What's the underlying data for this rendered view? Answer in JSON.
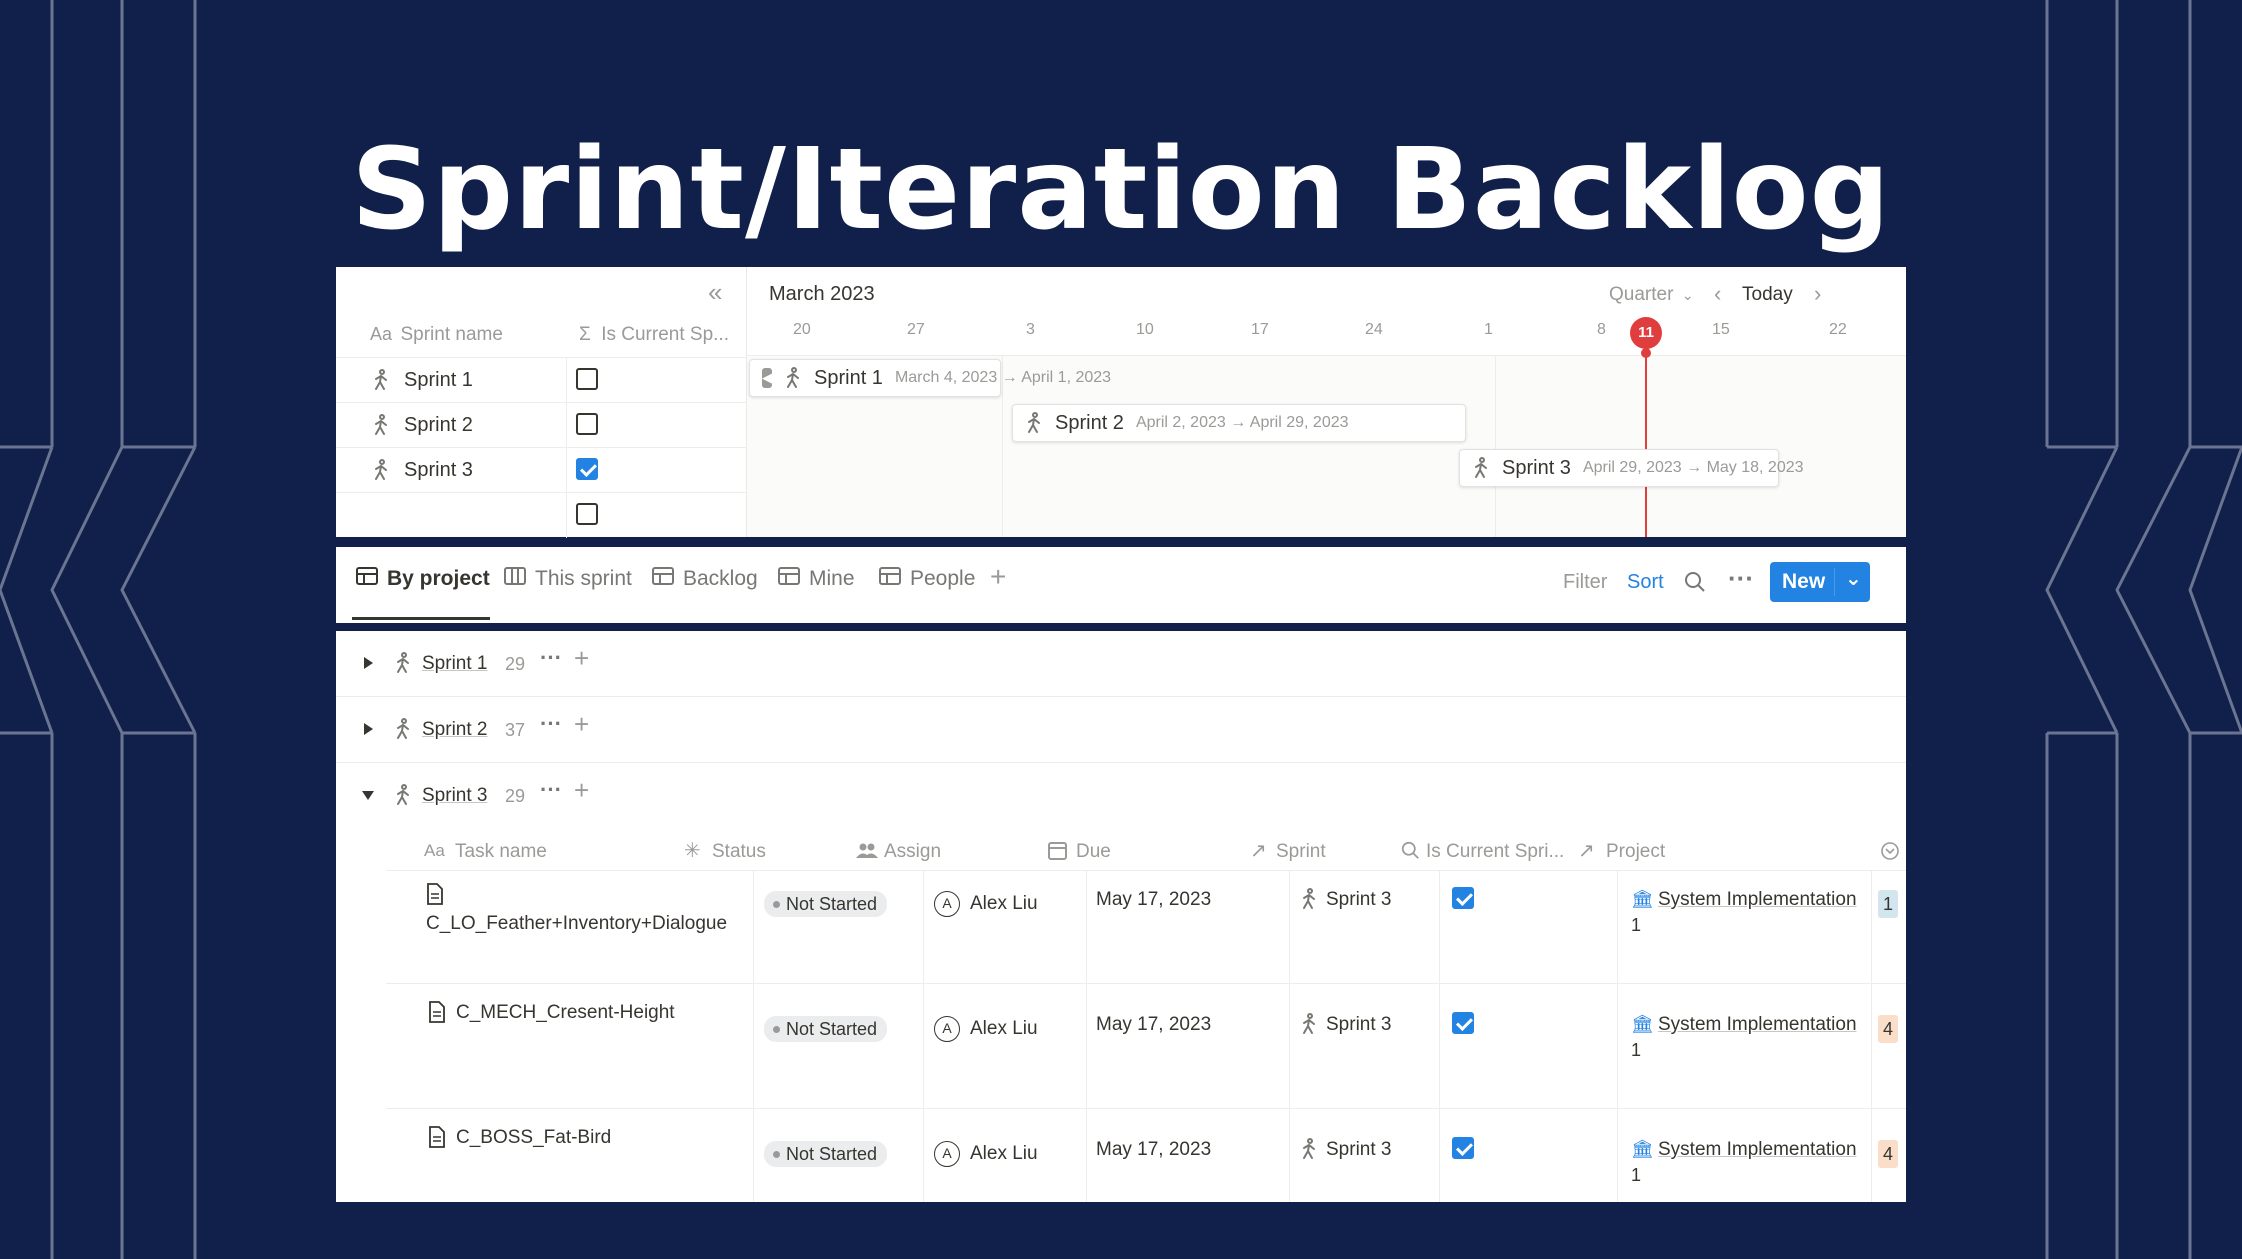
{
  "page_title": "Sprint/Iteration Backlog",
  "colors": {
    "background": "#11204a",
    "accent_blue": "#2383e2",
    "today_red": "#e03e3e",
    "tag_blue_bg": "#d3e5ef",
    "tag_orange_bg": "#fadec9"
  },
  "timeline": {
    "collapse_icon": "double-chevron-left-icon",
    "month_label": "March 2023",
    "view_selector": "Quarter",
    "today_label": "Today",
    "columns": {
      "name": "Sprint name",
      "current": "Is Current Sp..."
    },
    "dates": [
      "20",
      "27",
      "3",
      "10",
      "17",
      "24",
      "1",
      "8",
      "11",
      "15",
      "22"
    ],
    "rows": [
      {
        "name": "Sprint 1",
        "is_current": false
      },
      {
        "name": "Sprint 2",
        "is_current": false
      },
      {
        "name": "Sprint 3",
        "is_current": true
      },
      {
        "name": "",
        "is_current": false
      }
    ],
    "bars": [
      {
        "name": "Sprint 1",
        "range": "March 4, 2023 → April 1, 2023"
      },
      {
        "name": "Sprint 2",
        "range": "April 2, 2023 → April 29, 2023"
      },
      {
        "name": "Sprint 3",
        "range": "April 29, 2023 → May 18, 2023"
      }
    ]
  },
  "tabs": {
    "items": [
      {
        "label": "By project",
        "active": true
      },
      {
        "label": "This sprint",
        "active": false
      },
      {
        "label": "Backlog",
        "active": false
      },
      {
        "label": "Mine",
        "active": false
      },
      {
        "label": "People",
        "active": false
      }
    ],
    "filter_label": "Filter",
    "sort_label": "Sort",
    "new_label": "New"
  },
  "groups": [
    {
      "name": "Sprint 1",
      "count": "29",
      "expanded": false
    },
    {
      "name": "Sprint 2",
      "count": "37",
      "expanded": false
    },
    {
      "name": "Sprint 3",
      "count": "29",
      "expanded": true
    }
  ],
  "table": {
    "headers": {
      "task": "Task name",
      "status": "Status",
      "assign": "Assign",
      "due": "Due",
      "sprint": "Sprint",
      "current": "Is Current Spri...",
      "project": "Project"
    },
    "rows": [
      {
        "task": "C_LO_Feather+Inventory+Dialogue",
        "status": "Not Started",
        "assign_initial": "A",
        "assign": "Alex Liu",
        "due": "May 17, 2023",
        "sprint": "Sprint 3",
        "is_current": true,
        "project": "System Implementation",
        "project_count": "1",
        "extra": "1"
      },
      {
        "task": "C_MECH_Cresent-Height",
        "status": "Not Started",
        "assign_initial": "A",
        "assign": "Alex Liu",
        "due": "May 17, 2023",
        "sprint": "Sprint 3",
        "is_current": true,
        "project": "System Implementation",
        "project_count": "1",
        "extra": "4"
      },
      {
        "task": "C_BOSS_Fat-Bird",
        "status": "Not Started",
        "assign_initial": "A",
        "assign": "Alex Liu",
        "due": "May 17, 2023",
        "sprint": "Sprint 3",
        "is_current": true,
        "project": "System Implementation",
        "project_count": "1",
        "extra": "4"
      }
    ]
  }
}
